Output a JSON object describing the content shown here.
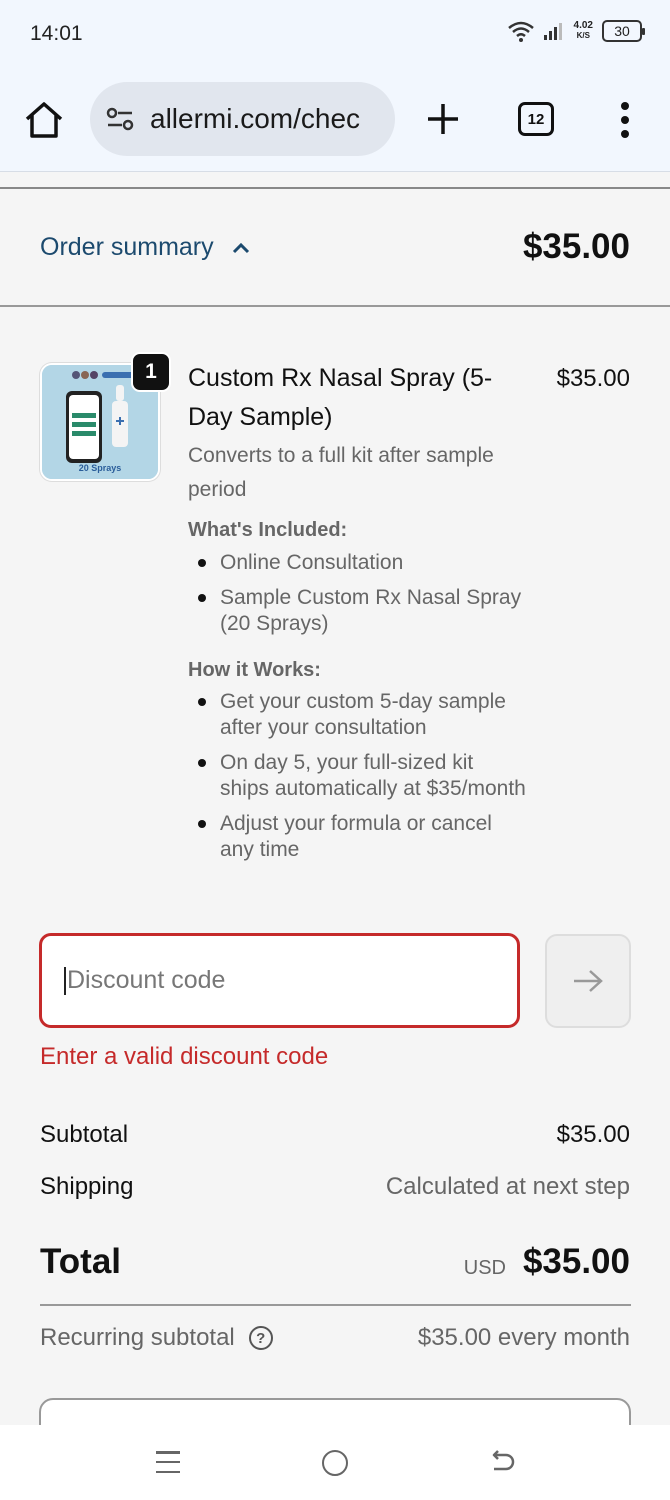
{
  "status_bar": {
    "time": "14:01",
    "speed_value": "4.02",
    "speed_unit": "K/S",
    "battery": "30"
  },
  "browser": {
    "url": "allermi.com/chec",
    "tab_count": "12",
    "icons": [
      "home-icon",
      "tune-icon",
      "plus-icon",
      "tabs-icon",
      "more-vert-icon"
    ]
  },
  "order_summary": {
    "label": "Order summary",
    "total": "$35.00"
  },
  "product": {
    "quantity": "1",
    "name": "Custom Rx Nasal Spray (5-Day Sample)",
    "price": "$35.00",
    "description": "Converts to a full kit after sample period",
    "thumbnail_caption": "20 Sprays",
    "included_heading": "What's Included:",
    "included": [
      "Online Consultation",
      "Sample Custom Rx Nasal Spray (20 Sprays)"
    ],
    "how_heading": "How it Works:",
    "how": [
      "Get your custom 5-day sample after your consultation",
      "On day 5, your full-sized kit ships automatically at $35/month",
      "Adjust your formula or cancel any time"
    ]
  },
  "discount": {
    "placeholder": "Discount code",
    "error": "Enter a valid discount code",
    "apply_icon": "arrow-right-icon"
  },
  "totals": {
    "subtotal_label": "Subtotal",
    "subtotal_value": "$35.00",
    "shipping_label": "Shipping",
    "shipping_value": "Calculated at next step",
    "total_label": "Total",
    "currency": "USD",
    "total_value": "$35.00",
    "recurring_label": "Recurring subtotal",
    "recurring_value": "$35.00 every month"
  },
  "colors": {
    "accent_link": "#1c4a6e",
    "error": "#c52a2a",
    "browser_chrome": "#f2f7fe"
  }
}
